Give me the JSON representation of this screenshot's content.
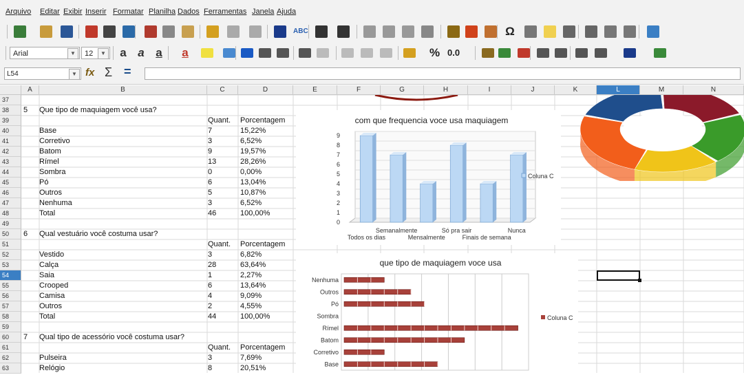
{
  "menu": [
    "Arquivo",
    "Editar",
    "Exibir",
    "Inserir",
    "Formatar",
    "Planilha",
    "Dados",
    "Ferramentas",
    "Janela",
    "Ajuda"
  ],
  "font": {
    "name": "Arial",
    "size": "12"
  },
  "name_box": "L54",
  "icons": {
    "function_wizard": "fx-icon",
    "sum": "Σ",
    "equals": "=",
    "special_char": "Ω",
    "percent": "%",
    "number": "0.0"
  },
  "columns": [
    {
      "name": "A"
    },
    {
      "name": "B"
    },
    {
      "name": "C"
    },
    {
      "name": "D"
    },
    {
      "name": "E"
    },
    {
      "name": "F"
    },
    {
      "name": "G"
    },
    {
      "name": "H"
    },
    {
      "name": "I"
    },
    {
      "name": "J"
    },
    {
      "name": "K"
    },
    {
      "name": "L"
    },
    {
      "name": "M"
    },
    {
      "name": "N"
    }
  ],
  "rows": [
    "37",
    "38",
    "39",
    "40",
    "41",
    "42",
    "43",
    "44",
    "45",
    "46",
    "47",
    "48",
    "49",
    "50",
    "51",
    "52",
    "53",
    "54",
    "55",
    "56",
    "57",
    "58",
    "59",
    "60",
    "61",
    "62",
    "63"
  ],
  "selected_row": "54",
  "selected_col": "L",
  "cells": [
    {
      "r": 1,
      "a": "5",
      "b": "Que tipo de maquiagem você usa?",
      "c": "",
      "d": ""
    },
    {
      "r": 2,
      "a": "",
      "b": "",
      "c": "Quant.",
      "d": "Porcentagem"
    },
    {
      "r": 3,
      "a": "",
      "b": "Base",
      "c": "7",
      "d": "15,22%"
    },
    {
      "r": 4,
      "a": "",
      "b": "Corretivo",
      "c": "3",
      "d": "6,52%"
    },
    {
      "r": 5,
      "a": "",
      "b": "Batom",
      "c": "9",
      "d": "19,57%"
    },
    {
      "r": 6,
      "a": "",
      "b": "Rímel",
      "c": "13",
      "d": "28,26%"
    },
    {
      "r": 7,
      "a": "",
      "b": "Sombra",
      "c": "0",
      "d": "0,00%"
    },
    {
      "r": 8,
      "a": "",
      "b": "Pó",
      "c": "6",
      "d": "13,04%"
    },
    {
      "r": 9,
      "a": "",
      "b": "Outros",
      "c": "5",
      "d": "10,87%"
    },
    {
      "r": 10,
      "a": "",
      "b": "Nenhuma",
      "c": "3",
      "d": "6,52%"
    },
    {
      "r": 11,
      "a": "",
      "b": "Total",
      "c": "46",
      "d": "100,00%"
    },
    {
      "r": 13,
      "a": "6",
      "b": "Qual vestuário você costuma usar?",
      "c": "",
      "d": ""
    },
    {
      "r": 14,
      "a": "",
      "b": "",
      "c": "Quant.",
      "d": "Porcentagem"
    },
    {
      "r": 15,
      "a": "",
      "b": "Vestido",
      "c": "3",
      "d": "6,82%"
    },
    {
      "r": 16,
      "a": "",
      "b": "Calça",
      "c": "28",
      "d": "63,64%"
    },
    {
      "r": 17,
      "a": "",
      "b": "Saia",
      "c": "1",
      "d": "2,27%"
    },
    {
      "r": 18,
      "a": "",
      "b": "Crooped",
      "c": "6",
      "d": "13,64%"
    },
    {
      "r": 19,
      "a": "",
      "b": "Camisa",
      "c": "4",
      "d": "9,09%"
    },
    {
      "r": 20,
      "a": "",
      "b": "Outros",
      "c": "2",
      "d": "4,55%"
    },
    {
      "r": 21,
      "a": "",
      "b": "Total",
      "c": "44",
      "d": "100,00%"
    },
    {
      "r": 23,
      "a": "7",
      "b": "Qual tipo de acessório você costuma usar?",
      "c": "",
      "d": ""
    },
    {
      "r": 24,
      "a": "",
      "b": "",
      "c": "Quant.",
      "d": "Porcentagem"
    },
    {
      "r": 25,
      "a": "",
      "b": "Pulseira",
      "c": "3",
      "d": "7,69%"
    },
    {
      "r": 26,
      "a": "",
      "b": "Relógio",
      "c": "8",
      "d": "20,51%"
    }
  ],
  "chart_data": [
    {
      "type": "bar",
      "title": "com que frequencia voce usa maquiagem",
      "categories": [
        "Todos os dias",
        "Semanalmente",
        "Mensalmente",
        "Só pra sair",
        "Finais de semana",
        "Nunca"
      ],
      "series": [
        {
          "name": "Coluna C",
          "values": [
            9,
            7,
            4,
            8,
            4,
            7
          ]
        }
      ],
      "ylim": [
        0,
        9
      ],
      "yticks": [
        "0",
        "1",
        "2",
        "3",
        "4",
        "5",
        "6",
        "7",
        "8",
        "9"
      ],
      "legend": "right",
      "color": "#bcd8f4"
    },
    {
      "type": "bar",
      "orientation": "horizontal",
      "title": "que tipo de maquiagem voce usa",
      "categories": [
        "Nenhuma",
        "Outros",
        "Pó",
        "Sombra",
        "Rímel",
        "Batom",
        "Corretivo",
        "Base"
      ],
      "series": [
        {
          "name": "Coluna C",
          "values": [
            3,
            5,
            6,
            0,
            13,
            9,
            3,
            7
          ]
        }
      ],
      "xlim": [
        0,
        14
      ],
      "legend": "right",
      "color": "#a8413a"
    },
    {
      "type": "pie",
      "style": "donut-3d",
      "colors": [
        "#1f4e8c",
        "#8b1a2a",
        "#3a9b2a",
        "#f0c419",
        "#f25e1b"
      ]
    }
  ]
}
